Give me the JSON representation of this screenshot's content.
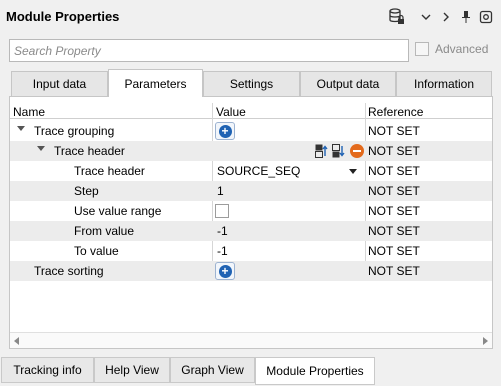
{
  "window": {
    "title": "Module Properties",
    "icons": [
      "database-lock-icon",
      "chevron-down-icon",
      "chevron-right-icon",
      "pin-icon",
      "settings-icon"
    ]
  },
  "search": {
    "placeholder": "Search Property",
    "value": ""
  },
  "advanced": {
    "label": "Advanced",
    "checked": false
  },
  "tabs": [
    {
      "label": "Input data"
    },
    {
      "label": "Parameters"
    },
    {
      "label": "Settings"
    },
    {
      "label": "Output data"
    },
    {
      "label": "Information"
    }
  ],
  "active_tab": "Parameters",
  "grid": {
    "columns": {
      "name": "Name",
      "value": "Value",
      "reference": "Reference"
    },
    "rows": [
      {
        "name": "Trace grouping",
        "value": "",
        "reference": "NOT SET"
      },
      {
        "name": "Trace header",
        "value": "",
        "reference": "NOT SET"
      },
      {
        "name": "Trace header",
        "value": "SOURCE_SEQ",
        "reference": "NOT SET"
      },
      {
        "name": "Step",
        "value": "1",
        "reference": "NOT SET"
      },
      {
        "name": "Use value range",
        "value": "",
        "reference": "NOT SET"
      },
      {
        "name": "From value",
        "value": "-1",
        "reference": "NOT SET"
      },
      {
        "name": "To value",
        "value": "-1",
        "reference": "NOT SET"
      },
      {
        "name": "Trace sorting",
        "value": "",
        "reference": "NOT SET"
      }
    ]
  },
  "bottom_tabs": [
    {
      "label": "Tracking info"
    },
    {
      "label": "Help View"
    },
    {
      "label": "Graph View"
    },
    {
      "label": "Module Properties"
    }
  ],
  "active_bottom_tab": "Module Properties"
}
